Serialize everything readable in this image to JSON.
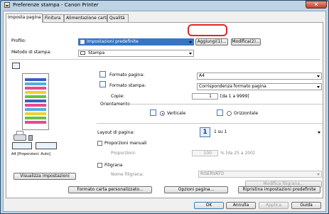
{
  "window": {
    "title": "Preferenze stampa - Canon Printer",
    "close_glyph": "✕"
  },
  "tabs": [
    {
      "label": "Imposta pagina"
    },
    {
      "label": "Finitura"
    },
    {
      "label": "Alimentazione carta"
    },
    {
      "label": "Qualità"
    }
  ],
  "profile": {
    "label": "Profilo:",
    "value": "Impostazioni predefinite",
    "add_button": "Aggiungi(1)...",
    "modify_button": "Modifica(2)..."
  },
  "output_method": {
    "label": "Metodo di stampa:",
    "value": "Stampa"
  },
  "page_size": {
    "label": "Formato pagina:",
    "value": "A4"
  },
  "output_size": {
    "label": "Formato stampa:",
    "value": "Corrispondenza formato pagina"
  },
  "copies": {
    "label": "Copie:",
    "value": "1",
    "range": "[da 1 a 9999]"
  },
  "orientation": {
    "label": "Orientamento",
    "portrait": "Verticale",
    "landscape": "Orizzontale",
    "selected": "Verticale"
  },
  "page_layout": {
    "label": "Layout di pagina:",
    "value": "1 su 1",
    "icon_text": "1"
  },
  "manual_scaling": {
    "label": "Proporzioni manuali",
    "checked": false,
    "scaling_label": "Proporzioni:",
    "scaling_value": "100",
    "scaling_range": "% [da 25 a 200]"
  },
  "watermark": {
    "label": "Filigrana",
    "checked": false,
    "name_label": "Nome filigrana:",
    "name_value": "RISERVATO",
    "edit_button": "Modifica filigrana..."
  },
  "preview": {
    "caption": "A4 [Proporzioni: Auto]",
    "view_settings_button": "Visualizza impostazioni"
  },
  "bottom_buttons": {
    "custom_paper": "Formato carta personalizzato...",
    "page_options": "Opzioni pagina...",
    "restore_defaults": "Ripristina impostazioni predefinite"
  },
  "dialog_buttons": {
    "ok": "OK",
    "cancel": "Annulla",
    "apply": "Applica",
    "help": "Guida"
  },
  "colors": {
    "highlight": "#e0262f",
    "selection": "#3376c5"
  }
}
